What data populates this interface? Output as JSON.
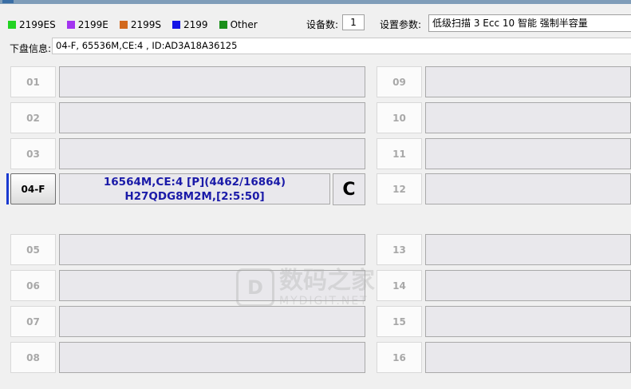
{
  "legend": [
    {
      "label": "2199ES",
      "color": "#22d322"
    },
    {
      "label": "2199E",
      "color": "#a334f0"
    },
    {
      "label": "2199S",
      "color": "#d2691e"
    },
    {
      "label": "2199",
      "color": "#1414e6"
    },
    {
      "label": "Other",
      "color": "#1a8f1a"
    }
  ],
  "device_count": {
    "label": "设备数:",
    "value": "1"
  },
  "settings": {
    "label": "设置参数:",
    "value": "低级扫描 3 Ecc 10 智能 强制半容量"
  },
  "disk_info": {
    "label": "下盘信息:",
    "value": "04-F, 65536M,CE:4 , ID:AD3A18A36125"
  },
  "slots": [
    {
      "id": "01"
    },
    {
      "id": "02"
    },
    {
      "id": "03"
    },
    {
      "id": "04-F",
      "line1": "16564M,CE:4 [P](4462/16864)",
      "line2": "H27QDG8M2M,[2:5:50]",
      "grade": "C"
    },
    {
      "id": "05"
    },
    {
      "id": "06"
    },
    {
      "id": "07"
    },
    {
      "id": "08"
    },
    {
      "id": "09"
    },
    {
      "id": "10"
    },
    {
      "id": "11"
    },
    {
      "id": "12"
    },
    {
      "id": "13"
    },
    {
      "id": "14"
    },
    {
      "id": "15"
    },
    {
      "id": "16"
    }
  ],
  "watermark": {
    "logo": "D",
    "cn": "数码之家",
    "en": "MYDIGIT.NET"
  }
}
